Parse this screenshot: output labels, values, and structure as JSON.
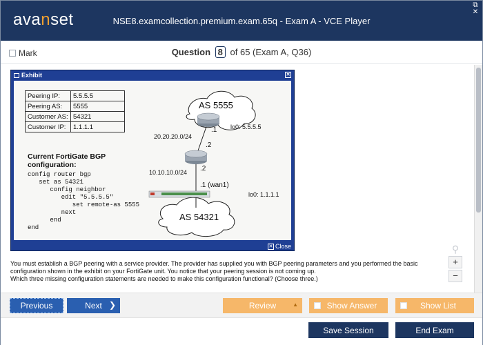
{
  "app": {
    "logo_pre": "ava",
    "logo_accent": "n",
    "logo_post": "set",
    "title": "NSE8.examcollection.premium.exam.65q - Exam A - VCE Player",
    "window_controls": [
      "⧉",
      "✕"
    ]
  },
  "header": {
    "mark_label": "Mark",
    "question_label": "Question",
    "question_number": "8",
    "question_of": "of 65 (Exam A, Q36)"
  },
  "exhibit": {
    "title": "Exhibit",
    "close_label": "Close",
    "peering_table": [
      {
        "key": "Peering IP:",
        "value": "5.5.5.5"
      },
      {
        "key": "Peering AS:",
        "value": "5555"
      },
      {
        "key": "Customer AS:",
        "value": "54321"
      },
      {
        "key": "Customer IP:",
        "value": "1.1.1.1"
      }
    ],
    "config_title": "Current FortiGate BGP configuration:",
    "config_code": "config router bgp\n   set as 54321\n      config neighbor\n         edit \"5.5.5.5\"\n            set remote-as 5555\n         next\n      end\nend",
    "diagram": {
      "as_top": "AS 5555",
      "as_bottom": "AS 54321",
      "lo0_top": "lo0: 5.5.5.5",
      "lo0_bottom": "lo0: 1.1.1.1",
      "net_upper": "20.20.20.0/24",
      "net_lower": "10.10.10.0/24",
      "r1_iface": ".1",
      "r2_up_iface": ".2",
      "r2_down_iface": ".2",
      "fgt_iface": ".1  (wan1)"
    }
  },
  "question": {
    "line1": "You must establish a BGP peering with a service provider. The provider has supplied you with BGP peering parameters and you performed the basic configuration shown in the exhibit on your FortiGate unit. You notice that your peering session is not coming up.",
    "line2": "Which three missing configuration statements are needed to make this configuration functional? (Choose three.)"
  },
  "zoom": {
    "in": "+",
    "out": "−"
  },
  "nav": {
    "previous": "Previous",
    "next": "Next",
    "review": "Review",
    "show_answer": "Show Answer",
    "show_list": "Show List"
  },
  "footer": {
    "save": "Save Session",
    "end": "End Exam"
  },
  "colors": {
    "brand_navy": "#1d3660",
    "nav_blue": "#2a5fb0",
    "nav_orange": "#f6b769",
    "exhibit_blue": "#1f3f94",
    "logo_accent": "#f0a030"
  }
}
